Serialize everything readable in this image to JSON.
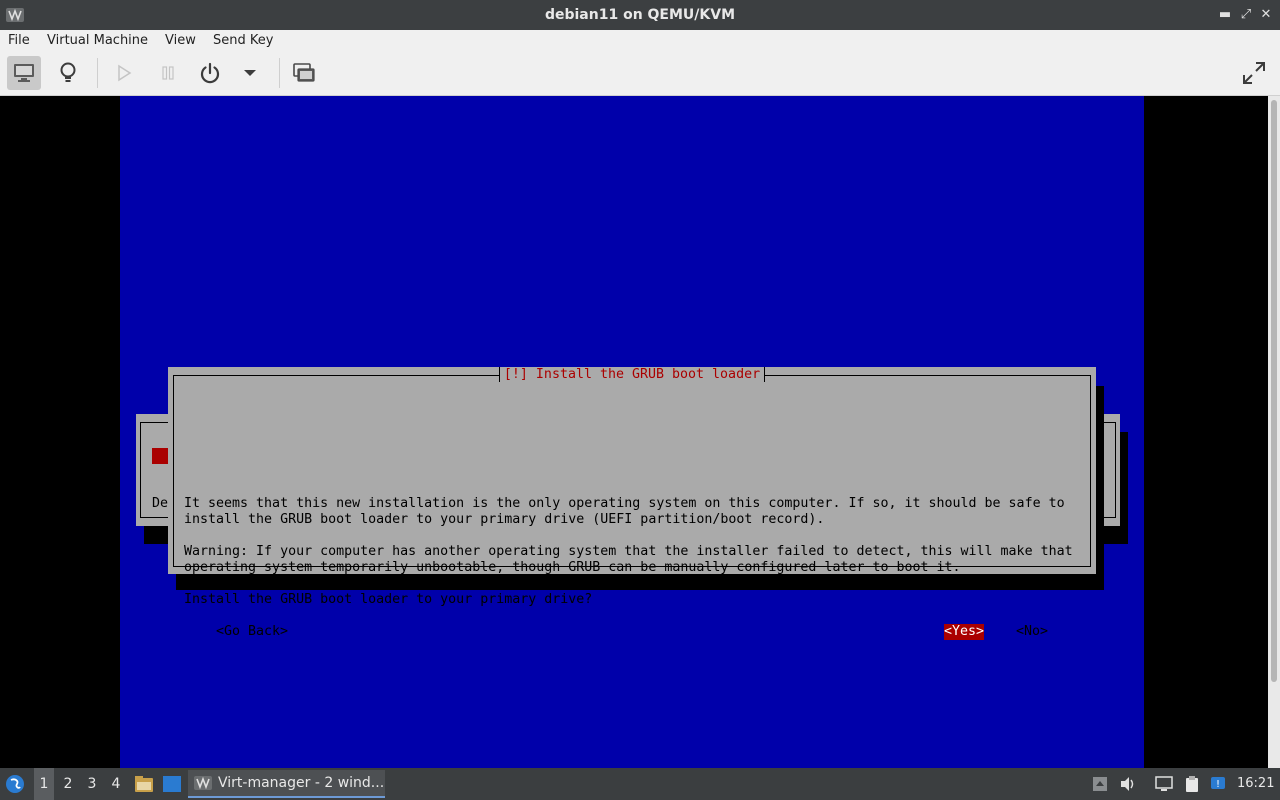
{
  "window": {
    "title": "debian11 on QEMU/KVM"
  },
  "menu": [
    "File",
    "Virtual Machine",
    "View",
    "Send Key"
  ],
  "toolbar": {
    "buttons": [
      "show-console",
      "show-details",
      "run",
      "pause",
      "shutdown",
      "shutdown-menu",
      "snapshots",
      "fullscreen"
    ]
  },
  "installer": {
    "background_dialog": {
      "partial_text": "De"
    },
    "dialog": {
      "title": "[!] Install the GRUB boot loader",
      "paragraph1": [
        "It seems that this new installation is the only operating system on this computer. If so, it should be safe to",
        "install the GRUB boot loader to your primary drive (UEFI partition/boot record)."
      ],
      "paragraph2": [
        "Warning: If your computer has another operating system that the installer failed to detect, this will make that",
        "operating system temporarily unbootable, though GRUB can be manually configured later to boot it."
      ],
      "question": "Install the GRUB boot loader to your primary drive?",
      "buttons": {
        "back": "<Go Back>",
        "yes": "<Yes>",
        "no": "<No>"
      },
      "selected_button": "yes"
    }
  },
  "taskbar": {
    "workspaces": [
      "1",
      "2",
      "3",
      "4"
    ],
    "active_workspace": "1",
    "task": "Virt-manager - 2 wind...",
    "clock": "16:21"
  },
  "colors": {
    "installer_bg": "#0000aa",
    "dialog_bg": "#aaaaaa",
    "accent_red": "#aa0000"
  }
}
